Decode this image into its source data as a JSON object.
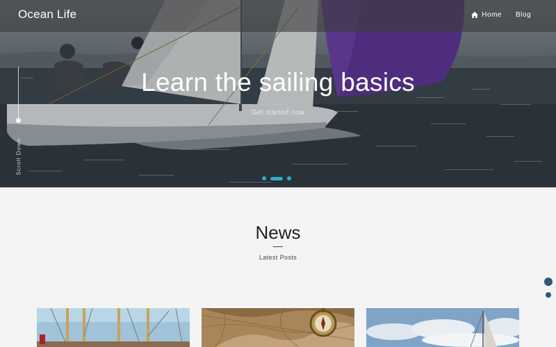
{
  "header": {
    "brand": "Ocean Life",
    "nav": [
      {
        "label": "Home",
        "icon": "home-icon"
      },
      {
        "label": "Blog"
      }
    ]
  },
  "hero": {
    "title": "Learn the sailing basics",
    "cta": "Get started now",
    "scroll_label": "Scroll Down",
    "slides": 3,
    "active_slide": 2
  },
  "news": {
    "title": "News",
    "subtitle": "Latest Posts"
  },
  "colors": {
    "accent": "#2ab0c4",
    "section_dot": "#2e5a7a",
    "background": "#f4f4f4"
  }
}
